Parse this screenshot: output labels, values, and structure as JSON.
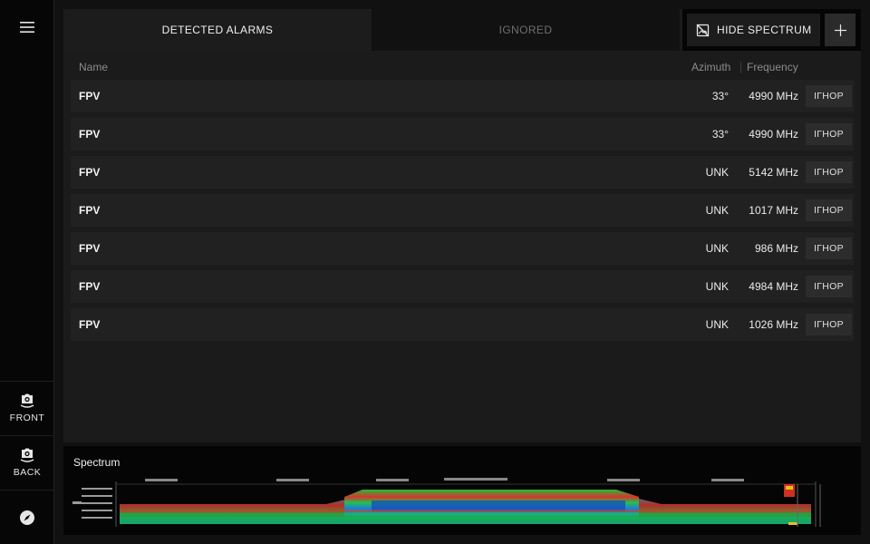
{
  "tabs": [
    {
      "label": "DETECTED ALARMS",
      "active": true
    },
    {
      "label": "IGNORED",
      "active": false
    }
  ],
  "toolbar": {
    "hide_spectrum_label": "HIDE SPECTRUM",
    "hide_spectrum_icon": "image-off-icon",
    "add_icon": "plus-icon"
  },
  "columns": {
    "name": "Name",
    "azimuth": "Azimuth",
    "frequency": "Frequency"
  },
  "alarms": [
    {
      "name": "FPV",
      "azimuth": "33°",
      "frequency": "4990 MHz",
      "action": "ІГНОР"
    },
    {
      "name": "FPV",
      "azimuth": "33°",
      "frequency": "4990 MHz",
      "action": "ІГНОР"
    },
    {
      "name": "FPV",
      "azimuth": "UNK",
      "frequency": "5142 MHz",
      "action": "ІГНОР"
    },
    {
      "name": "FPV",
      "azimuth": "UNK",
      "frequency": "1017 MHz",
      "action": "ІГНОР"
    },
    {
      "name": "FPV",
      "azimuth": "UNK",
      "frequency": "986 MHz",
      "action": "ІГНОР"
    },
    {
      "name": "FPV",
      "azimuth": "UNK",
      "frequency": "4984 MHz",
      "action": "ІГНОР"
    },
    {
      "name": "FPV",
      "azimuth": "UNK",
      "frequency": "1026 MHz",
      "action": "ІГНОР"
    }
  ],
  "sidebar": {
    "menu_icon": "hamburger-menu-icon",
    "front_label": "FRONT",
    "back_label": "BACK",
    "compass_icon": "compass-icon"
  },
  "spectrum": {
    "title": "Spectrum"
  },
  "colors": {
    "background": "#161616",
    "sidebar": "#060606",
    "row": "#212121",
    "button": "#2c2c2c"
  }
}
